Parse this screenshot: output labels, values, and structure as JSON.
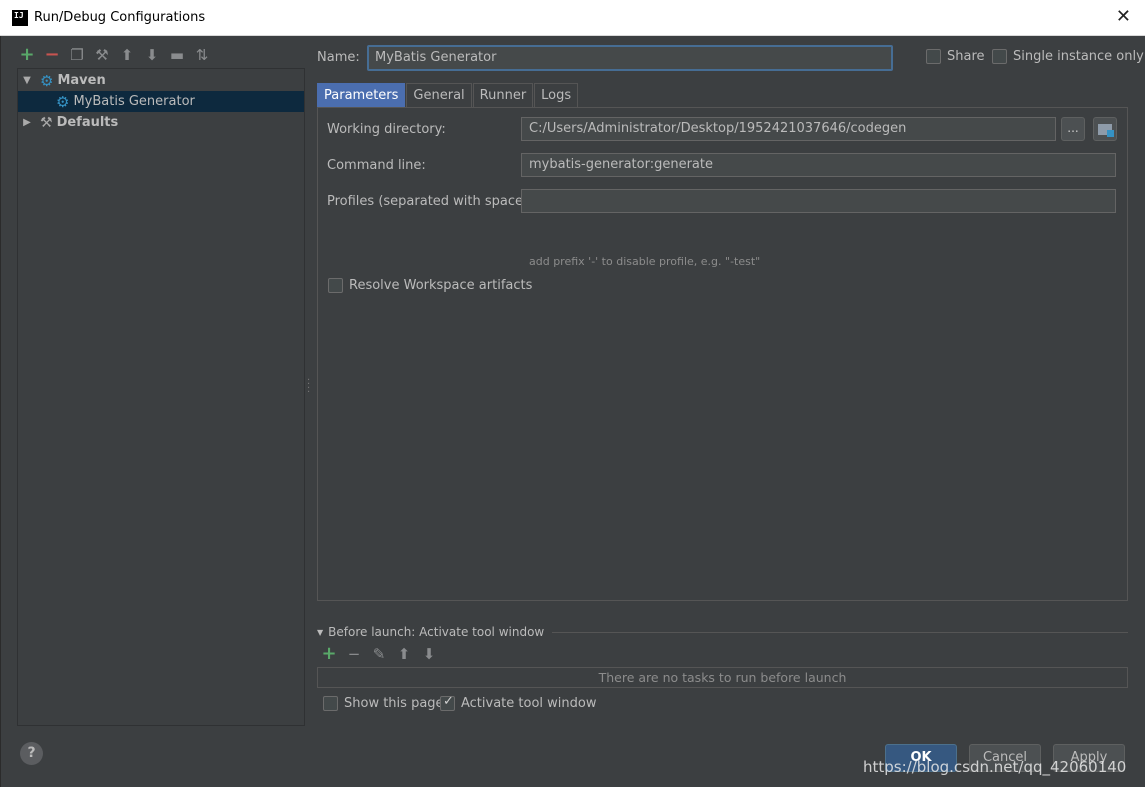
{
  "window": {
    "title": "Run/Debug Configurations",
    "app_icon_text": "IJ",
    "close_glyph": "✕"
  },
  "toolbar": {
    "icons": [
      "add-icon",
      "remove-icon",
      "copy-icon",
      "edit-defaults-icon",
      "move-up-icon",
      "move-down-icon",
      "folder-icon",
      "sort-icon"
    ]
  },
  "tree": {
    "items": [
      {
        "label": "Maven",
        "expanded": true
      },
      {
        "label": "MyBatis Generator",
        "selected": true
      },
      {
        "label": "Defaults",
        "expanded": false
      }
    ]
  },
  "header": {
    "name_label": "Name:",
    "name_value": "MyBatis Generator",
    "share_label": "Share",
    "single_instance_label": "Single instance only"
  },
  "tabs": [
    "Parameters",
    "General",
    "Runner",
    "Logs"
  ],
  "parameters": {
    "working_directory_label": "Working directory:",
    "working_directory_value": "C:/Users/Administrator/Desktop/1952421037646/codegen",
    "browse_button": "...",
    "command_line_label": "Command line:",
    "command_line_value": "mybatis-generator:generate",
    "profiles_label": "Profiles (separated with space):",
    "profiles_value": "",
    "profiles_hint": "add prefix '-' to disable profile, e.g. \"-test\"",
    "resolve_workspace_label": "Resolve Workspace artifacts",
    "resolve_workspace_checked": false
  },
  "before_launch": {
    "title": "Before launch: Activate tool window",
    "empty_text": "There are no tasks to run before launch",
    "show_page_label": "Show this page",
    "show_page_checked": false,
    "activate_tool_window_label": "Activate tool window",
    "activate_tool_window_checked": true
  },
  "footer": {
    "help_glyph": "?",
    "ok_label": "OK",
    "cancel_label": "Cancel",
    "apply_label": "Apply"
  },
  "watermark": "https://blog.csdn.net/qq_42060140",
  "colors": {
    "background": "#3c3f41",
    "selection": "#0d293e",
    "accent": "#4b6eaf",
    "add_green": "#59a869",
    "remove_red": "#c75450",
    "maven_blue": "#3592c4"
  }
}
